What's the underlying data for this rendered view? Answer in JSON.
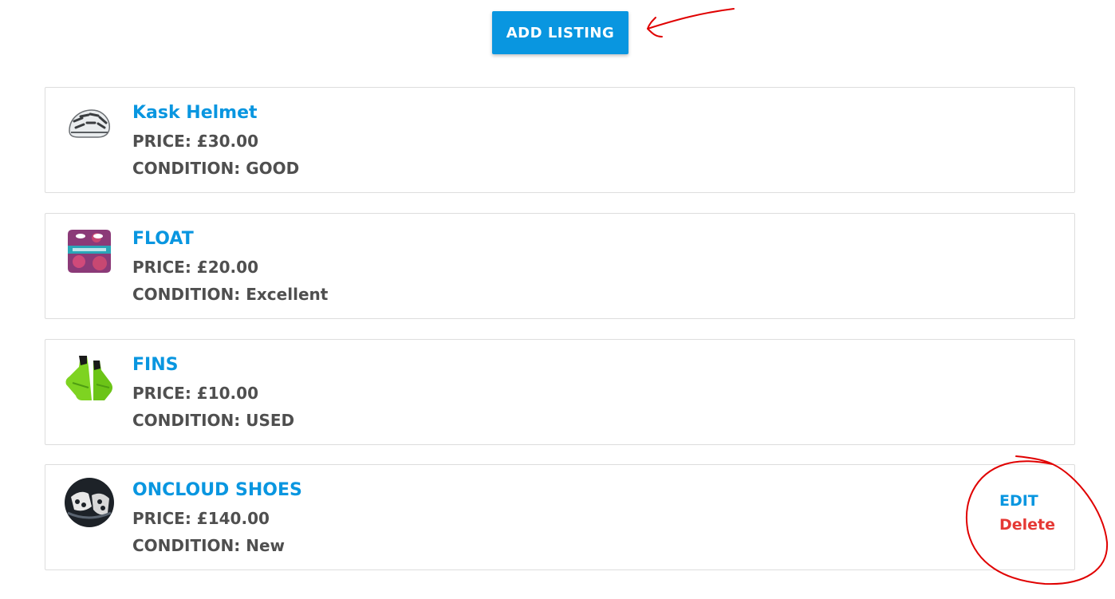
{
  "add_button": {
    "label": "ADD LISTING"
  },
  "listings": [
    {
      "title": "Kask Helmet",
      "price": "PRICE: £30.00",
      "condition": "CONDITION: GOOD",
      "image_icon": "helmet"
    },
    {
      "title": "FLOAT",
      "price": "PRICE: £20.00",
      "condition": "CONDITION: Excellent",
      "image_icon": "swim-float"
    },
    {
      "title": "FINS",
      "price": "PRICE: £10.00",
      "condition": "CONDITION: USED",
      "image_icon": "swim-fins"
    },
    {
      "title": "ONCLOUD SHOES",
      "price": "PRICE: £140.00",
      "condition": "CONDITION: New",
      "image_icon": "running-shoes",
      "actions": {
        "edit": "EDIT",
        "delete": "Delete"
      }
    }
  ],
  "colors": {
    "accent": "#0996e0",
    "text": "#4f4f4f",
    "danger": "#e53935",
    "annotation": "#e00000"
  }
}
